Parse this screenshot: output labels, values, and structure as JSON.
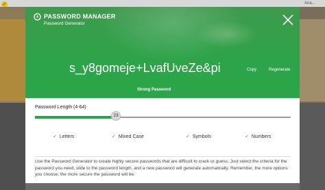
{
  "app": {
    "title": "PASSWORD MANAGER",
    "subtitle": "Password Generator"
  },
  "password": {
    "value": "s_y8gomeje+LvafUveZe&pi",
    "strength": "Strong Password"
  },
  "actions": {
    "copy": "Copy",
    "regenerate": "Regenerate"
  },
  "length": {
    "label": "Password Length (4-64)",
    "min": 4,
    "max": 64,
    "value": 23,
    "value_text": "23"
  },
  "options": [
    {
      "label": "Letters",
      "checked": true
    },
    {
      "label": "Mixed Case",
      "checked": true
    },
    {
      "label": "Symbols",
      "checked": true
    },
    {
      "label": "Numbers",
      "checked": true
    }
  ],
  "description": "Use the Password Generator to create highly secure passwords that are difficult to crack or guess. Just select the criteria for the password you need, slide to the password length, and a new password will generate automatically. Remember, the more options you choose, the more secure the password will be.",
  "background": {
    "corner_text": "Ana..."
  },
  "icons": {
    "logo": "password-manager-logo-icon",
    "close": "close-icon",
    "check": "checkmark-icon"
  },
  "colors": {
    "accent": "#2aa648",
    "header": "#3f9a4e"
  }
}
